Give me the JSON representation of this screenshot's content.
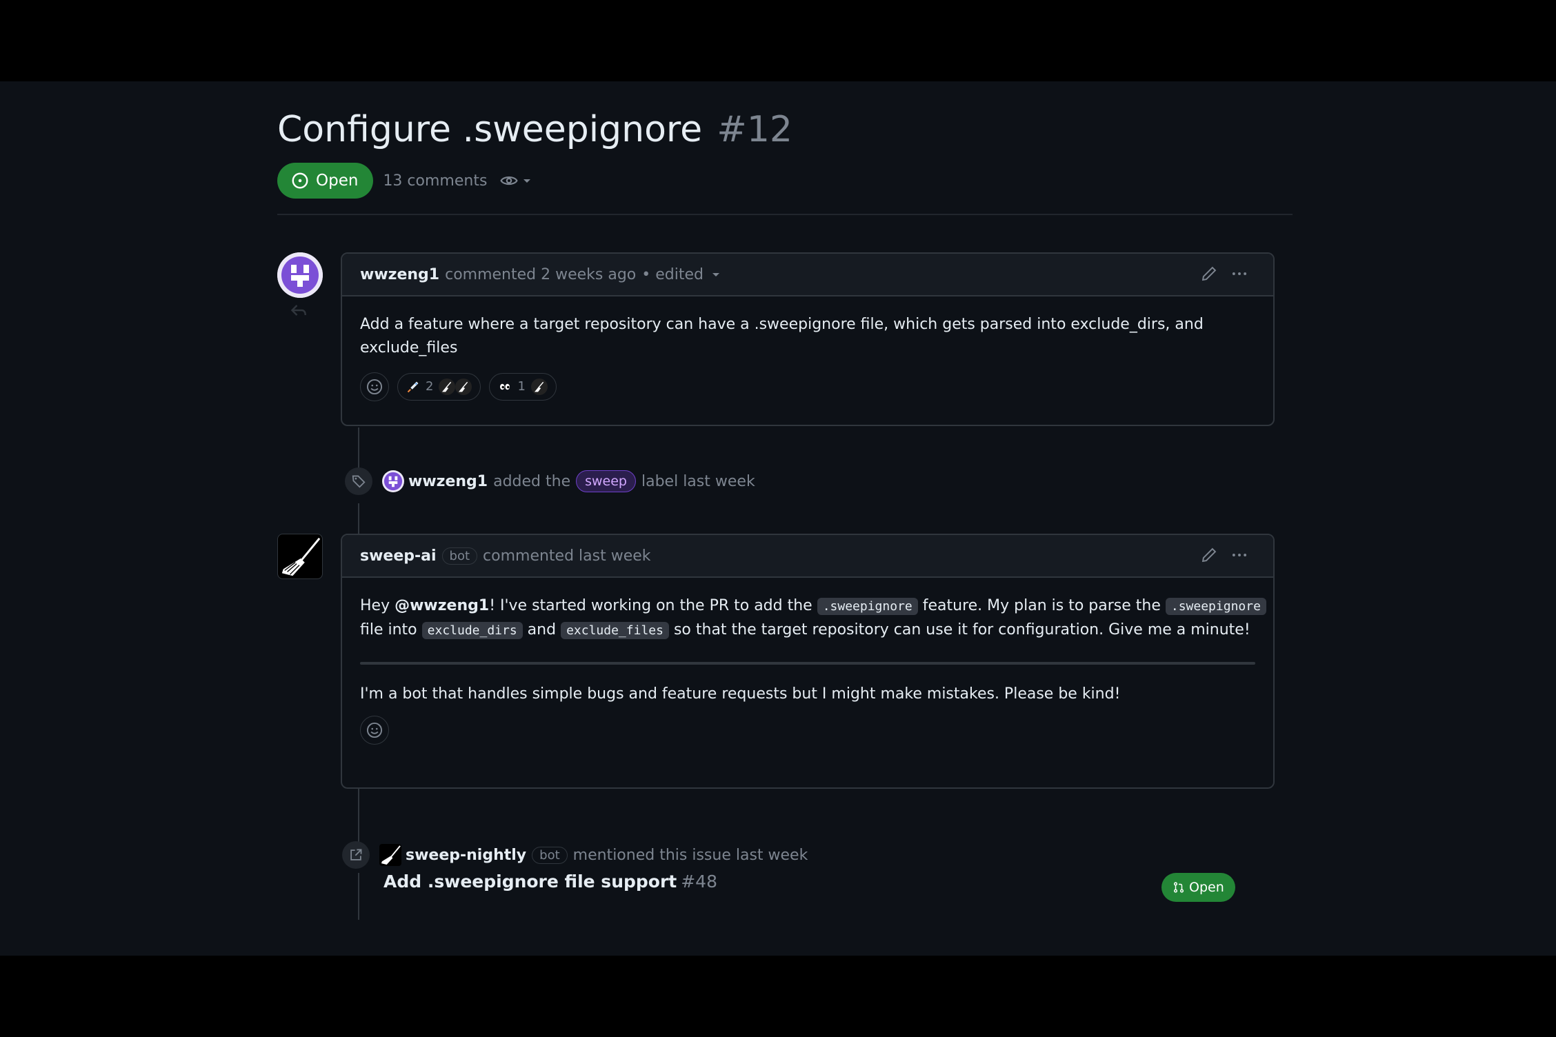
{
  "issue": {
    "title": "Configure .sweepignore",
    "number": "#12",
    "state": "Open",
    "comments_count": "13 comments"
  },
  "comment1": {
    "author": "wwzeng1",
    "meta": "commented 2 weeks ago",
    "edited": "• edited",
    "body_line1": "Add a feature where a target repository can have a .sweepignore file, which gets parsed into exclude_dirs, and",
    "body_line2": "exclude_files",
    "reactions": [
      {
        "icon": "rocket-icon",
        "count": "2"
      },
      {
        "icon": "eyes-icon",
        "count": "1"
      }
    ]
  },
  "label_event": {
    "actor": "wwzeng1",
    "text_before": "added the",
    "label": "sweep",
    "text_after": "label last week"
  },
  "comment2": {
    "author": "sweep-ai",
    "bot": "bot",
    "meta": "commented last week",
    "p1_hey": "Hey ",
    "p1_mention": "@wwzeng1",
    "p1_a": "! I've started working on the PR to add the ",
    "code1": ".sweepignore",
    "p1_b": " feature. My plan is to parse the ",
    "code2": ".sweepignore",
    "p1_c": "file into ",
    "code3": "exclude_dirs",
    "p1_d": " and ",
    "code4": "exclude_files",
    "p1_e": " so that the target repository can use it for configuration. Give me a minute!",
    "p2": "I'm a bot that handles simple bugs and feature requests but I might make mistakes. Please be kind!"
  },
  "mention_event": {
    "actor": "sweep-nightly",
    "bot": "bot",
    "text": "mentioned this issue last week",
    "ref_title": "Add .sweepignore file support",
    "ref_number": "#48",
    "ref_state": "Open"
  },
  "colors": {
    "open_green": "#238636",
    "background": "#0d1117",
    "border": "#30363d",
    "muted": "#7d8590",
    "label_purple": "#d2a8ff",
    "avatar_purple": "#7b4fd6"
  }
}
